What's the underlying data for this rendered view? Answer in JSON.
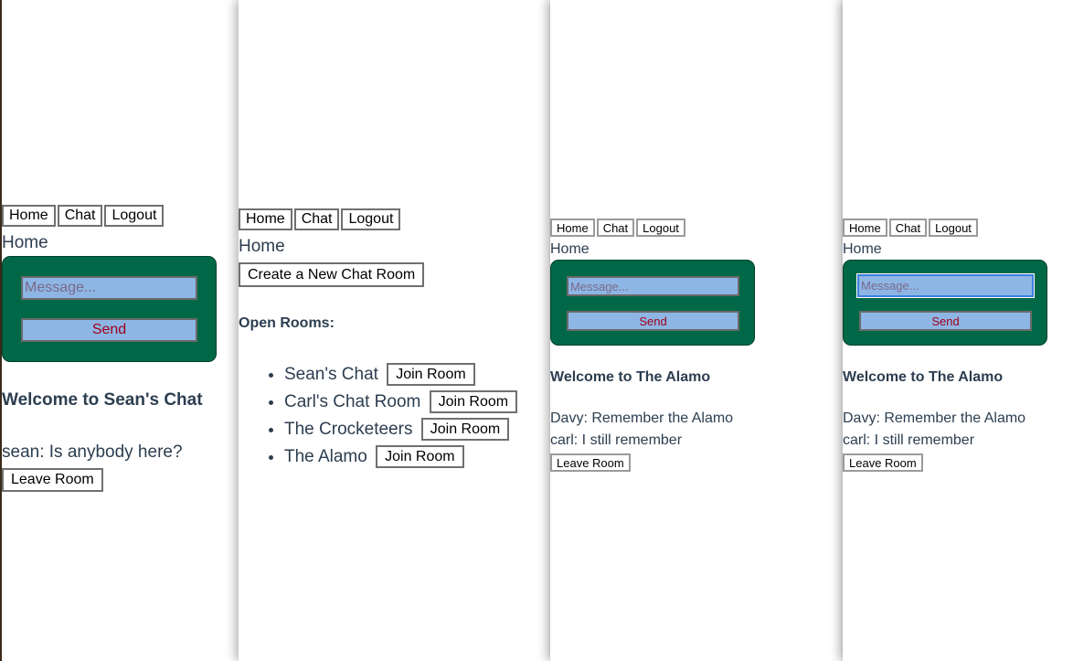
{
  "nav": {
    "home": "Home",
    "chat": "Chat",
    "logout": "Logout"
  },
  "page_heading": "Home",
  "message_placeholder": "Message...",
  "send_label": "Send",
  "leave_label": "Leave Room",
  "panel1": {
    "welcome": "Welcome to Sean's Chat",
    "messages": [
      "sean: Is anybody here?"
    ]
  },
  "panel2": {
    "create_label": "Create a New Chat Room",
    "open_rooms_label": "Open Rooms:",
    "join_label": "Join Room",
    "rooms": [
      "Sean's Chat",
      "Carl's Chat Room",
      "The Crocketeers",
      "The Alamo"
    ]
  },
  "panel3": {
    "welcome": "Welcome to The Alamo",
    "messages": [
      "Davy: Remember the Alamo",
      "carl: I still remember"
    ]
  },
  "panel4": {
    "welcome": "Welcome to The Alamo",
    "messages": [
      "Davy: Remember the Alamo",
      "carl: I still remember"
    ]
  }
}
